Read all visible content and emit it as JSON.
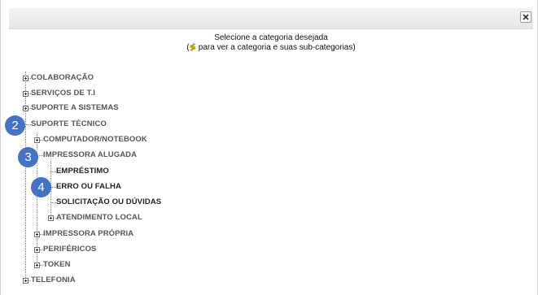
{
  "dialog": {
    "close_icon": "close-icon",
    "header_line1": "Selecione a categoria desejada",
    "header_hint_open": "(",
    "header_hint_arrow": "≸",
    "header_hint_text": " para ver a categoria e suas sub-categorias)"
  },
  "tree": {
    "colaboracao": "COLABORAÇÃO",
    "servicos_ti": "SERVIÇOS DE T.I",
    "suporte_sistemas": "SUPORTE A SISTEMAS",
    "suporte_tecnico": "SUPORTE TÉCNICO",
    "computador_notebook": "COMPUTADOR/NOTEBOOK",
    "impressora_alugada": "IMPRESSORA ALUGADA",
    "emprestimo": "EMPRÉSTIMO",
    "erro_falha": "ERRO OU FALHA",
    "solicitacao_duvidas": "SOLICITAÇÃO OU DÚVIDAS",
    "atendimento_local": "ATENDIMENTO LOCAL",
    "impressora_propria": "IMPRESSORA PRÓPRIA",
    "perifericos": "PERIFÉRICOS",
    "token": "TOKEN",
    "telefonia": "TELEFONIA"
  },
  "markers": {
    "m2": "2",
    "m3": "3",
    "m4": "4"
  }
}
